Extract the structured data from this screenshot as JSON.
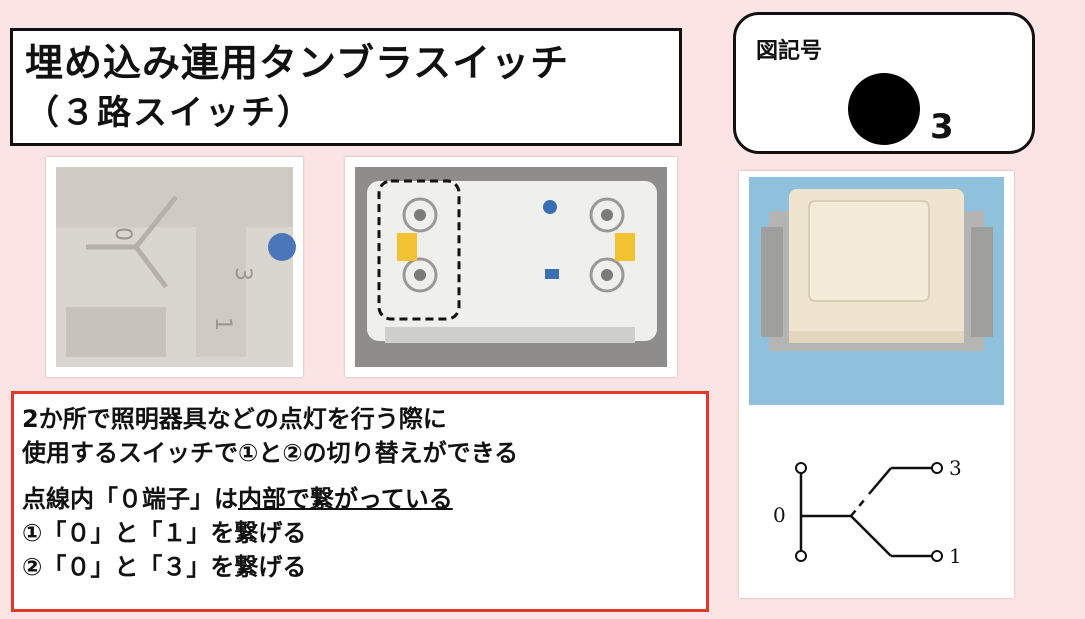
{
  "title": {
    "line1": "埋め込み連用タンブラスイッチ",
    "line2": "（３路スイッチ）"
  },
  "symbol": {
    "label": "図記号",
    "number": "3"
  },
  "description": {
    "line1": "2か所で照明器具などの点灯を行う際に",
    "line2": "使用するスイッチで①と②の切り替えができる",
    "line3_prefix": "点線内「０端子」は",
    "line3_underlined": "内部で繋がっている",
    "line4": "①「０」と「１」を繋げる",
    "line5": "②「０」と「３」を繋げる"
  },
  "photo_closeup": {
    "text_lines": [
      "0",
      "1",
      "3"
    ]
  },
  "diagram": {
    "terminal_0": "0",
    "terminal_1": "1",
    "terminal_3": "3"
  },
  "colors": {
    "background": "#fde4e4",
    "desc_border": "#e23a2a",
    "switch_body": "#efe4cf"
  }
}
